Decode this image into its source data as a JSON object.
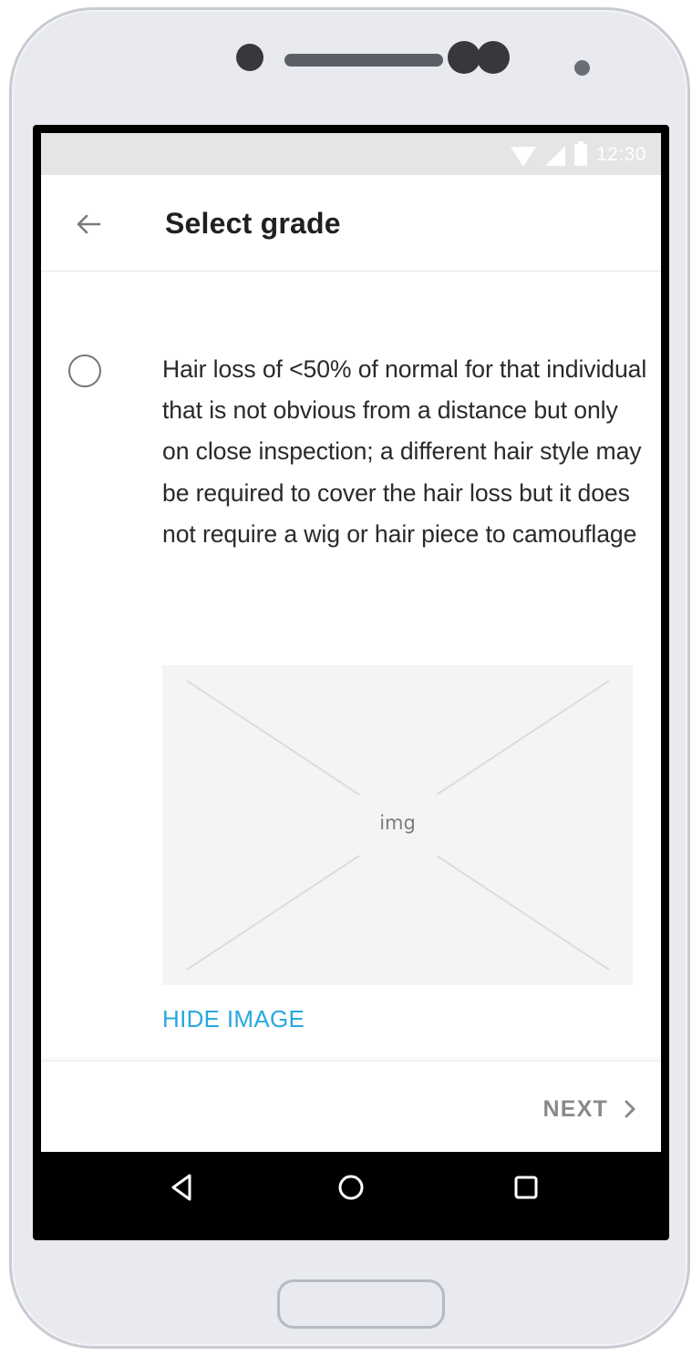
{
  "status_bar": {
    "time": "12:30",
    "icons": [
      "wifi-icon",
      "signal-icon",
      "battery-icon"
    ]
  },
  "app_bar": {
    "title": "Select grade",
    "back_icon": "arrow-left-icon"
  },
  "option": {
    "text": "Hair loss of <50% of normal for that individual that is not obvious from a distance but only on close inspection; a different hair style may be required to cover the hair loss but it does not require a wig or hair piece to camouflage",
    "selected": false
  },
  "image_placeholder": {
    "label": "img"
  },
  "actions": {
    "hide_image": "HIDE IMAGE",
    "next": "NEXT",
    "next_icon": "chevron-right-icon"
  },
  "navigation": {
    "icons": [
      "back-triangle-icon",
      "home-circle-icon",
      "recents-square-icon"
    ]
  },
  "colors": {
    "link": "#29a8df",
    "title": "#202020",
    "body_text": "#2a2a2a",
    "disabled_text": "#8a8a8a",
    "status_bar": "#e5e5e5",
    "placeholder_bg": "#f4f4f4",
    "device_frame": "#e9eaef"
  }
}
